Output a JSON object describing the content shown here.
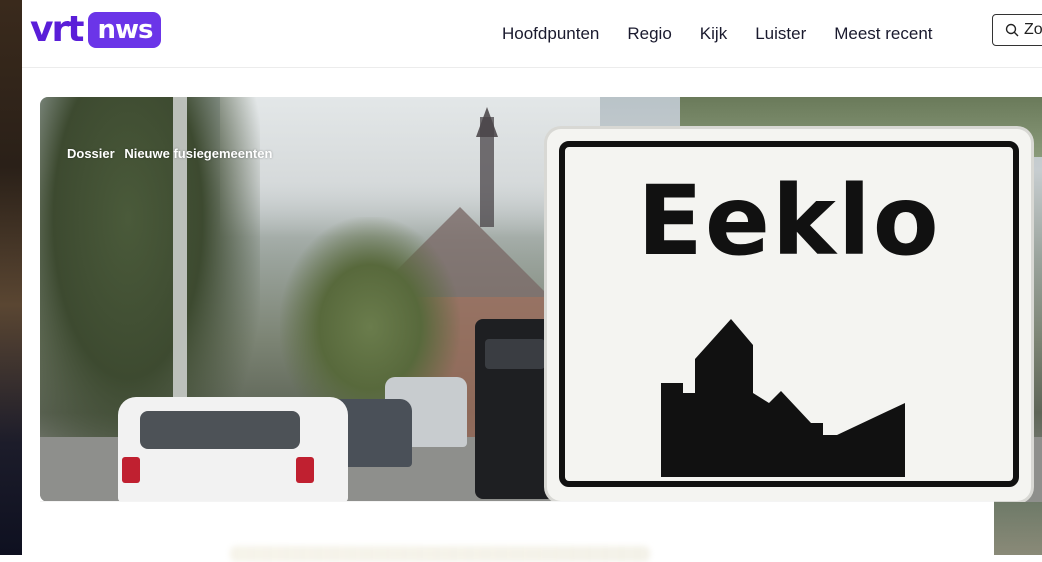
{
  "header": {
    "logo": {
      "brand": "vrt",
      "product": "nws",
      "color": "#5a1ed8"
    },
    "nav": [
      {
        "label": "Hoofdpunten"
      },
      {
        "label": "Regio"
      },
      {
        "label": "Kijk"
      },
      {
        "label": "Luister"
      },
      {
        "label": "Meest recent"
      }
    ],
    "search": {
      "label": "Zo",
      "icon": "search-icon"
    }
  },
  "hero": {
    "breadcrumb": {
      "section": "Dossier",
      "topic": "Nieuwe fusiegemeenten"
    },
    "sign_text": "Eeklo"
  }
}
